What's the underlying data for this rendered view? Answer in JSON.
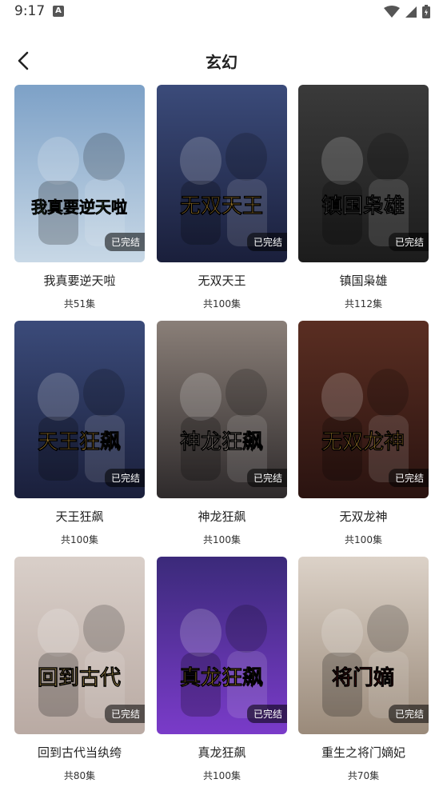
{
  "status": {
    "time": "9:17",
    "notification_glyph": "A"
  },
  "header": {
    "title": "玄幻"
  },
  "items": [
    {
      "title": "我真要逆天啦",
      "count": "共51集",
      "status": "已完结",
      "art": "我真要逆天啦",
      "colors": [
        "#7da1c7",
        "#c8d8e6",
        "#5d8a4e"
      ]
    },
    {
      "title": "无双天王",
      "count": "共100集",
      "status": "已完结",
      "art": "无双天王",
      "colors": [
        "#3b4b7a",
        "#1a1f3b",
        "#c89a3a"
      ]
    },
    {
      "title": "镇国枭雄",
      "count": "共112集",
      "status": "已完结",
      "art": "镇国枭雄",
      "colors": [
        "#3a3a3a",
        "#1c1c1c",
        "#8a8a8a"
      ]
    },
    {
      "title": "天王狂飙",
      "count": "共100集",
      "status": "已完结",
      "art": "天王狂飙",
      "colors": [
        "#3b4b7a",
        "#1a1f3b",
        "#c89a3a"
      ]
    },
    {
      "title": "神龙狂飙",
      "count": "共100集",
      "status": "已完结",
      "art": "神龙狂飙",
      "colors": [
        "#8a7f78",
        "#2e2a2b",
        "#b8aca3"
      ]
    },
    {
      "title": "无双龙神",
      "count": "共100集",
      "status": "已完结",
      "art": "无双龙神",
      "colors": [
        "#5a2e22",
        "#2a1310",
        "#d9a23b"
      ]
    },
    {
      "title": "回到古代当纨绔",
      "count": "共80集",
      "status": "已完结",
      "art": "回到古代",
      "colors": [
        "#d9cfc9",
        "#b9aaa3",
        "#e9c46a"
      ]
    },
    {
      "title": "真龙狂飙",
      "count": "共100集",
      "status": "已完结",
      "art": "真龙狂飙",
      "colors": [
        "#3b2a7a",
        "#7a3bc9",
        "#e9b23a"
      ]
    },
    {
      "title": "重生之将门嫡妃",
      "count": "共70集",
      "status": "已完结",
      "art": "将门嫡",
      "colors": [
        "#dcd2c8",
        "#9a8a7a",
        "#7a1d1d"
      ]
    }
  ]
}
